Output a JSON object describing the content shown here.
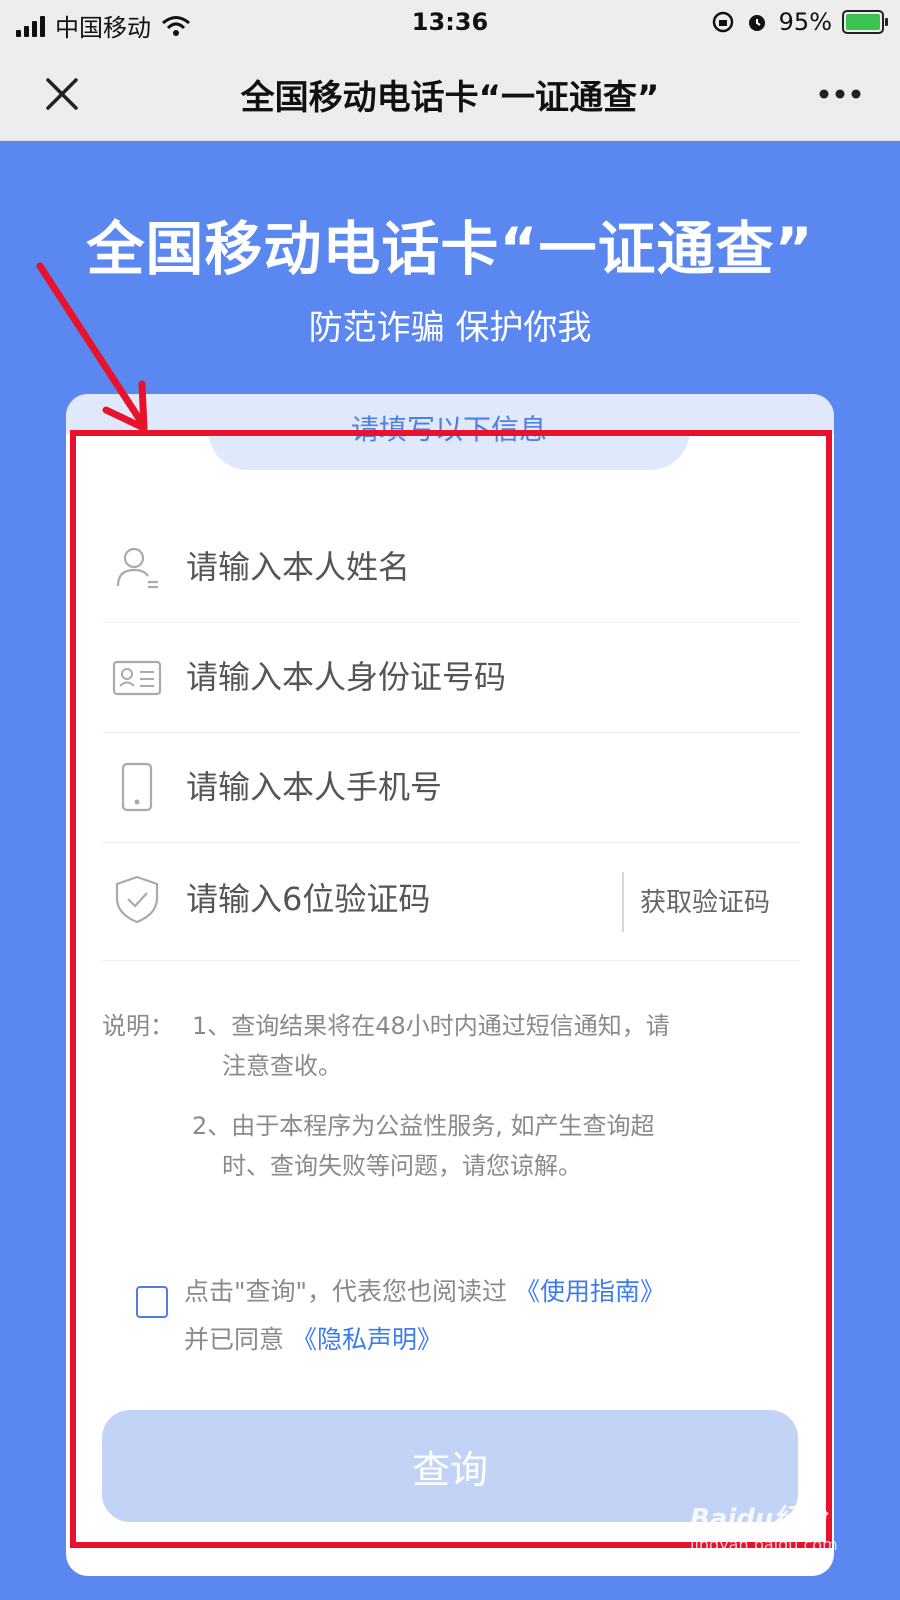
{
  "status_bar": {
    "carrier": "中国移动",
    "time": "13:36",
    "battery": "95%"
  },
  "nav": {
    "title": "全国移动电话卡“一证通查”"
  },
  "hero": {
    "title": "全国移动电话卡“一证通查”",
    "subtitle": "防范诈骗 保护你我"
  },
  "form": {
    "section_label": "请填写以下信息",
    "name_placeholder": "请输入本人姓名",
    "id_placeholder": "请输入本人身份证号码",
    "phone_placeholder": "请输入本人手机号",
    "code_placeholder": "请输入6位验证码",
    "get_code_label": "获取验证码"
  },
  "notes": {
    "label": "说明：",
    "item1_line1": "1、查询结果将在48小时内通过短信通知，请",
    "item1_line2": "注意查收。",
    "item2_line1": "2、由于本程序为公益性服务, 如产生查询超",
    "item2_line2": "时、查询失败等问题，请您谅解。"
  },
  "agreement": {
    "text1": "点击\"查询\"，代表您也阅读过",
    "link1": "《使用指南》",
    "text2": "并已同意",
    "link2": "《隐私声明》"
  },
  "submit_label": "查询",
  "watermark": {
    "brand": "Baidu经验",
    "url": "jingyan.baidu.com"
  },
  "colors": {
    "background": "#5b87f0",
    "accent": "#4f7fe0",
    "annotation": "#e8122c"
  }
}
